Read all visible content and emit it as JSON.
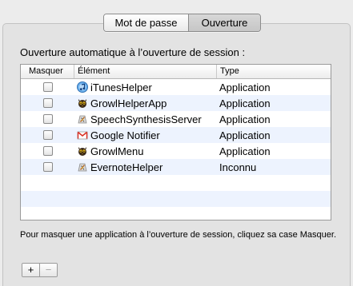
{
  "tabs": {
    "password_label": "Mot de passe",
    "login_items_label": "Ouverture"
  },
  "section": {
    "title": "Ouverture automatique à l’ouverture de session :"
  },
  "table": {
    "headers": {
      "hide": "Masquer",
      "item": "Élément",
      "type": "Type"
    },
    "rows": [
      {
        "name": "iTunesHelper",
        "type": "Application",
        "icon": "itunes-icon"
      },
      {
        "name": "GrowlHelperApp",
        "type": "Application",
        "icon": "growl-icon"
      },
      {
        "name": "SpeechSynthesisServer",
        "type": "Application",
        "icon": "generic-app-icon"
      },
      {
        "name": "Google Notifier",
        "type": "Application",
        "icon": "gmail-icon"
      },
      {
        "name": "GrowlMenu",
        "type": "Application",
        "icon": "growl-icon"
      },
      {
        "name": "EvernoteHelper",
        "type": "Inconnu",
        "icon": "generic-app-icon"
      }
    ]
  },
  "help_text": "Pour masquer une application à l’ouverture de session, cliquez sa case Masquer.",
  "buttons": {
    "add": "+",
    "remove": "−"
  }
}
